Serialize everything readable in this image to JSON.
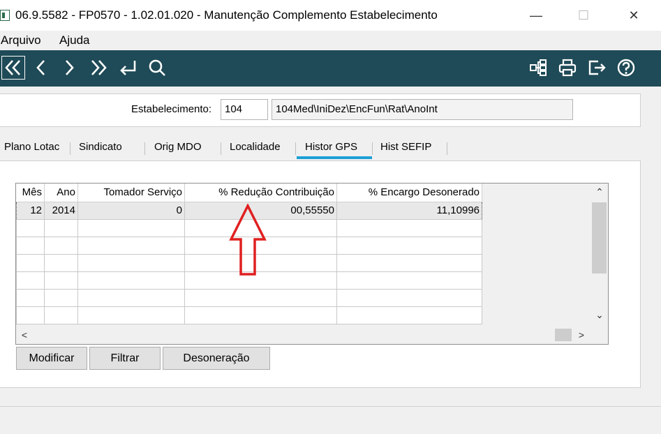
{
  "window": {
    "title": "06.9.5582 - FP0570 - 1.02.01.020 - Manutenção Complemento Estabelecimento",
    "minimize": "—",
    "maximize": "☐",
    "close": "✕"
  },
  "menu": {
    "arquivo": "Arquivo",
    "ajuda": "Ajuda"
  },
  "toolbar": {
    "icons": [
      "first-record-icon",
      "prev-record-icon",
      "next-record-icon",
      "last-record-icon",
      "enter-icon",
      "search-icon",
      "tree-icon",
      "print-icon",
      "exit-icon",
      "help-icon"
    ],
    "background": "#1f4a57"
  },
  "header": {
    "estab_label": "Estabelecimento:",
    "estab_code": "104",
    "estab_desc": "104Med\\IniDez\\EncFun\\Rat\\AnoInt"
  },
  "tabs": [
    "Plano Lotac",
    "Sindicato",
    "Orig MDO",
    "Localidade",
    "Histor GPS",
    "Hist SEFIP"
  ],
  "active_tab": "Histor GPS",
  "accent_color": "#1e9fd6",
  "grid": {
    "columns": [
      "Mês",
      "Ano",
      "Tomador Serviço",
      "% Redução Contribuição",
      "% Encargo Desonerado"
    ],
    "rows": [
      [
        "12",
        "2014",
        "0",
        "00,55550",
        "11,10996"
      ]
    ],
    "empty_rows": 6
  },
  "buttons": {
    "modificar": "Modificar",
    "filtrar": "Filtrar",
    "desoneracao": "Desoneração"
  },
  "annotation": {
    "color": "#e02020"
  }
}
